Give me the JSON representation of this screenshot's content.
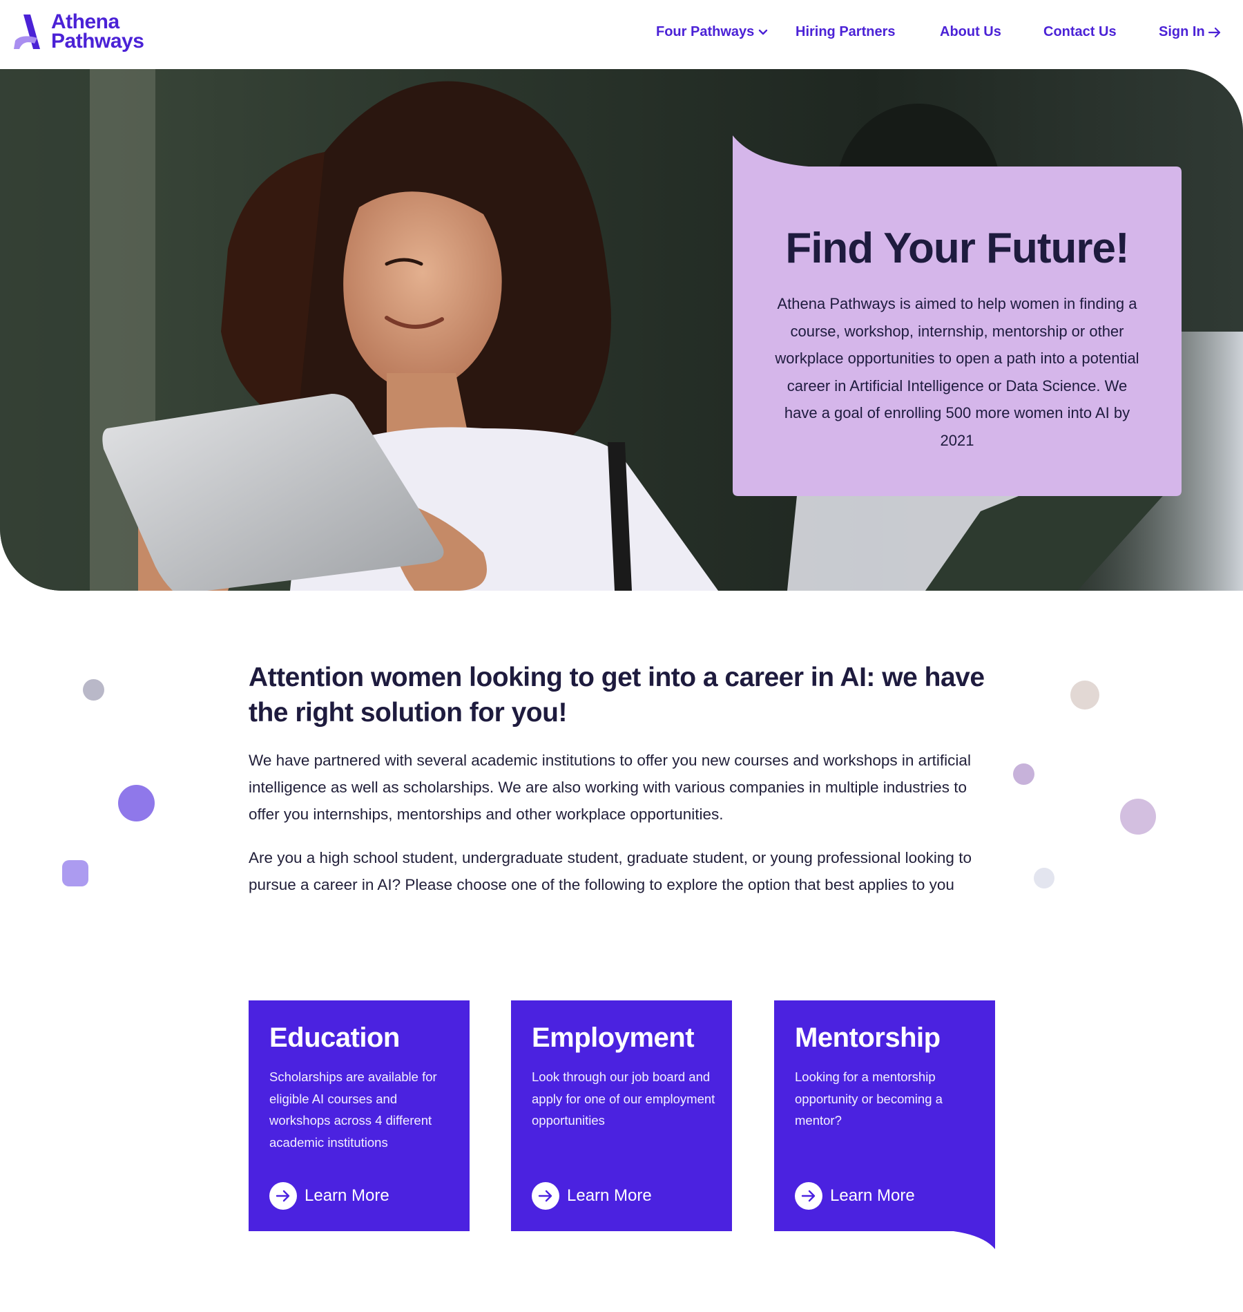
{
  "brand": {
    "line1": "Athena",
    "line2": "Pathways",
    "color": "#4b22d6"
  },
  "nav": {
    "items": [
      {
        "label": "Four Pathways",
        "icon": "chevron-down-icon"
      },
      {
        "label": "Hiring Partners"
      },
      {
        "label": "About Us"
      },
      {
        "label": "Contact Us"
      },
      {
        "label": "Sign In",
        "icon": "arrow-right-icon"
      }
    ]
  },
  "hero": {
    "title": "Find Your Future!",
    "text": "Athena Pathways is aimed to help women in finding a course, workshop, internship, mentorship or other workplace opportunities to open a path into a potential career in Artificial Intelligence or Data Science. We have a goal of enrolling 500 more women into AI by 2021",
    "card_color": "#d5b6ea"
  },
  "intro": {
    "heading": "Attention women looking to get into a career in AI: we have the right solution for you!",
    "paragraph1": "We have partnered with several academic institutions to offer you new courses and workshops in artificial intelligence as well as scholarships. We are also working with various companies in multiple industries to offer you internships, mentorships and other workplace opportunities.",
    "paragraph2": "Are you a high school student, undergraduate student, graduate student, or young professional looking to pursue a career in AI? Please choose one of the following to explore the option that best applies to you"
  },
  "cards": [
    {
      "title": "Education",
      "text": "Scholarships are available for eligible AI courses and workshops across 4 different academic institutions",
      "link": "Learn More"
    },
    {
      "title": "Employment",
      "text": "Look through our job board and apply for one of our employment opportunities",
      "link": "Learn More"
    },
    {
      "title": "Mentorship",
      "text": "Looking for a mentorship opportunity or becoming a mentor?",
      "link": "Learn More"
    }
  ],
  "colors": {
    "accent": "#4b22e0",
    "heading": "#1e1b3e",
    "lavender": "#d5b6ea"
  }
}
